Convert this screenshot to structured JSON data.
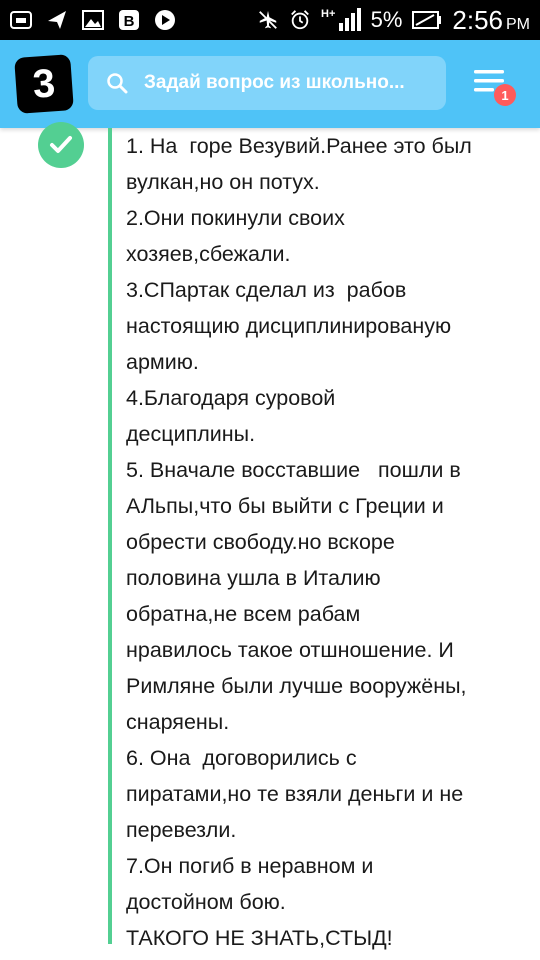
{
  "status_bar": {
    "icons_left": [
      "app-icon",
      "send-icon",
      "image-icon",
      "b-app-icon",
      "play-icon"
    ],
    "signal_label": "H+",
    "battery_percent": "5%",
    "time": "2:56",
    "ampm": "PM"
  },
  "header": {
    "logo_text": "3",
    "search_placeholder": "Задай вопрос из школьно...",
    "menu_badge": "1",
    "colors": {
      "header": "#4fc3f7",
      "search": "#81d4fa",
      "badge": "#ff5b5b"
    }
  },
  "answer": {
    "accent_color": "#53cf92",
    "lines": [
      "1. На  горе Везувий.Ранее это был",
      "вулкан,но он потух.",
      "2.Они покинули своих",
      "хозяев,сбежали.",
      "3.СПартак сделал из  рабов",
      "настоящию дисциплинированую",
      "армию.",
      "4.Благодаря суровой",
      "десциплины.",
      "5. Вначале восставшие   пошли в",
      "АЛьпы,что бы выйти с Греции и",
      "обрести свободу.но вскоре",
      "половина ушла в Италию",
      "обратна,не всем рабам",
      "нравилось такое отшношение. И",
      "Римляне были лучше вооружёны,",
      "снаряены.",
      "6. Она  договорились с",
      "пиратами,но те взяли деньги и не",
      "перевезли.",
      "7.Он погиб в неравном и",
      "достойном бою.",
      "ТАКОГО НЕ ЗНАТЬ,СТЫД!"
    ]
  }
}
